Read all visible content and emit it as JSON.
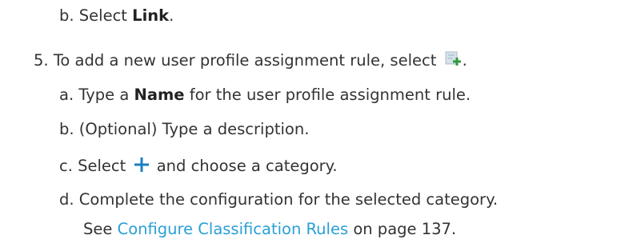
{
  "steps": {
    "step4b": {
      "marker": "b.",
      "prefix": "Select ",
      "bold": "Link",
      "suffix": "."
    },
    "step5": {
      "marker": "5.",
      "text": "To add a new user profile assignment rule, select",
      "icon": "add-rule-icon",
      "suffix": ".",
      "substeps": {
        "a": {
          "marker": "a.",
          "prefix": "Type a ",
          "bold": "Name",
          "suffix": " for the user profile assignment rule."
        },
        "b": {
          "marker": "b.",
          "text": "(Optional) Type a description."
        },
        "c": {
          "marker": "c.",
          "prefix": "Select",
          "icon": "plus-icon",
          "suffix": "and choose a category."
        },
        "d": {
          "marker": "d.",
          "text": "Complete the configuration for the selected category.",
          "see_prefix": "See ",
          "link_text": "Configure Classification Rules",
          "see_suffix": " on page 137."
        }
      }
    }
  },
  "colors": {
    "link": "#2a9fd6",
    "plus_icon": "#1a7fc0",
    "add_icon_bg": "#d6e2ea"
  }
}
